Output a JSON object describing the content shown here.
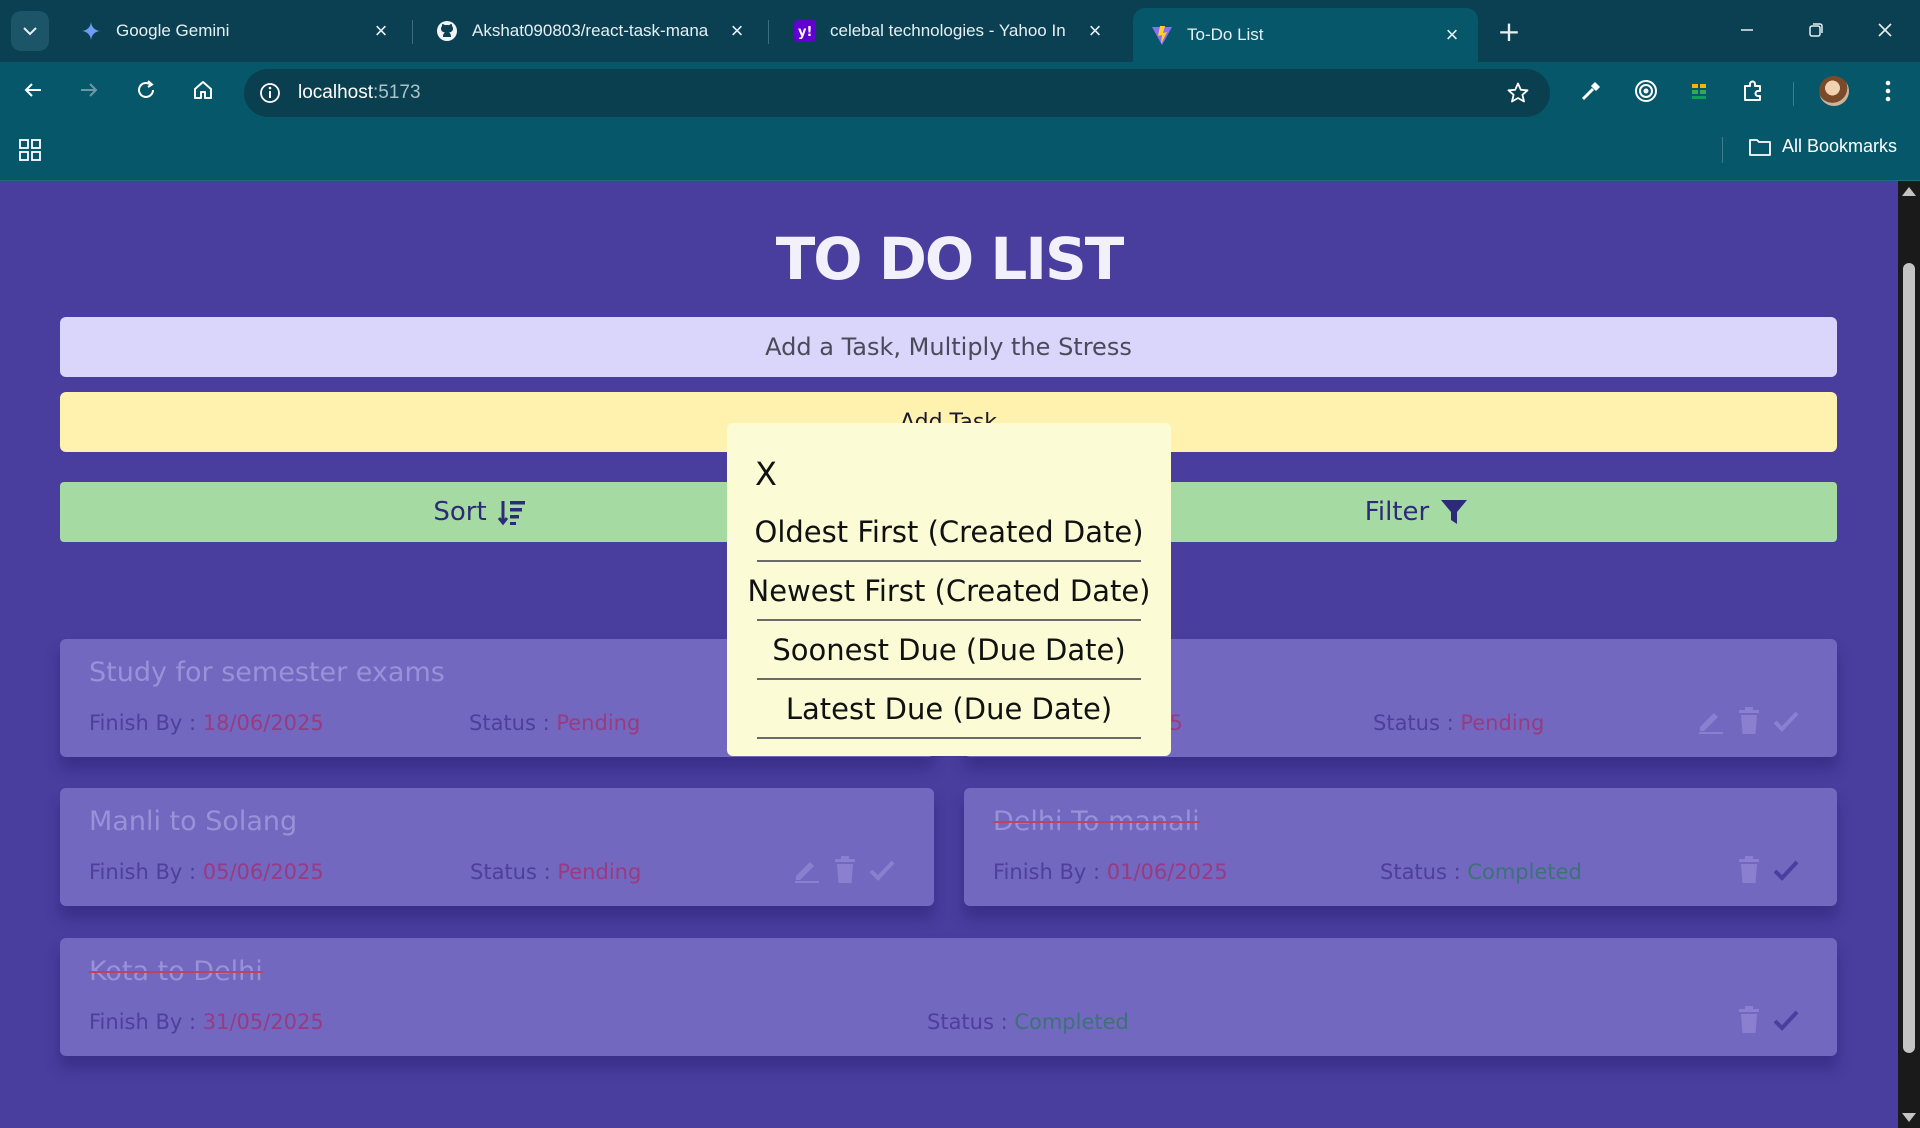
{
  "browser": {
    "tabs": [
      {
        "title": "Google Gemini",
        "icon": "gemini-icon"
      },
      {
        "title": "Akshat090803/react-task-mana",
        "icon": "github-icon"
      },
      {
        "title": "celebal technologies - Yahoo In",
        "icon": "yahoo-icon"
      },
      {
        "title": "To-Do List",
        "icon": "vite-icon",
        "active": true
      }
    ],
    "url_host": "localhost",
    "url_port": ":5173",
    "bookmarks_label": "All Bookmarks"
  },
  "app": {
    "title": "TO DO LIST",
    "input_placeholder": "Add a Task, Multiply the Stress",
    "add_button": "Add Task",
    "sort_button": "Sort",
    "filter_button": "Filter"
  },
  "tasks": [
    {
      "title": "Study for semester exams",
      "finish_label": "Finish By : ",
      "finish": "18/06/2025",
      "status_label": "Status : ",
      "status": "Pending"
    },
    {
      "title": "",
      "finish_label": "",
      "finish": "25",
      "status_label": "Status : ",
      "status": "Pending"
    },
    {
      "title": "Manli to Solang",
      "finish_label": "Finish By : ",
      "finish": "05/06/2025",
      "status_label": "Status : ",
      "status": "Pending"
    },
    {
      "title": "Delhi To manali",
      "finish_label": "Finish By : ",
      "finish": "01/06/2025",
      "status_label": "Status : ",
      "status": "Completed"
    },
    {
      "title": "Kota to Delhi",
      "finish_label": "Finish By : ",
      "finish": "31/05/2025",
      "status_label": "Status : ",
      "status": "Completed"
    }
  ],
  "sort_modal": {
    "close": "X",
    "options": [
      "Oldest First (Created Date)",
      "Newest First (Created Date)",
      "Soonest Due (Due Date)",
      "Latest Due (Due Date)"
    ]
  },
  "colors": {
    "page_bg": "#493d9e",
    "input_bg": "#dad5fb",
    "add_bg": "#fff2af",
    "sort_filter_bg": "#a6daa3",
    "card_bg": "#7268c0",
    "modal_bg": "#fbfbd6"
  }
}
